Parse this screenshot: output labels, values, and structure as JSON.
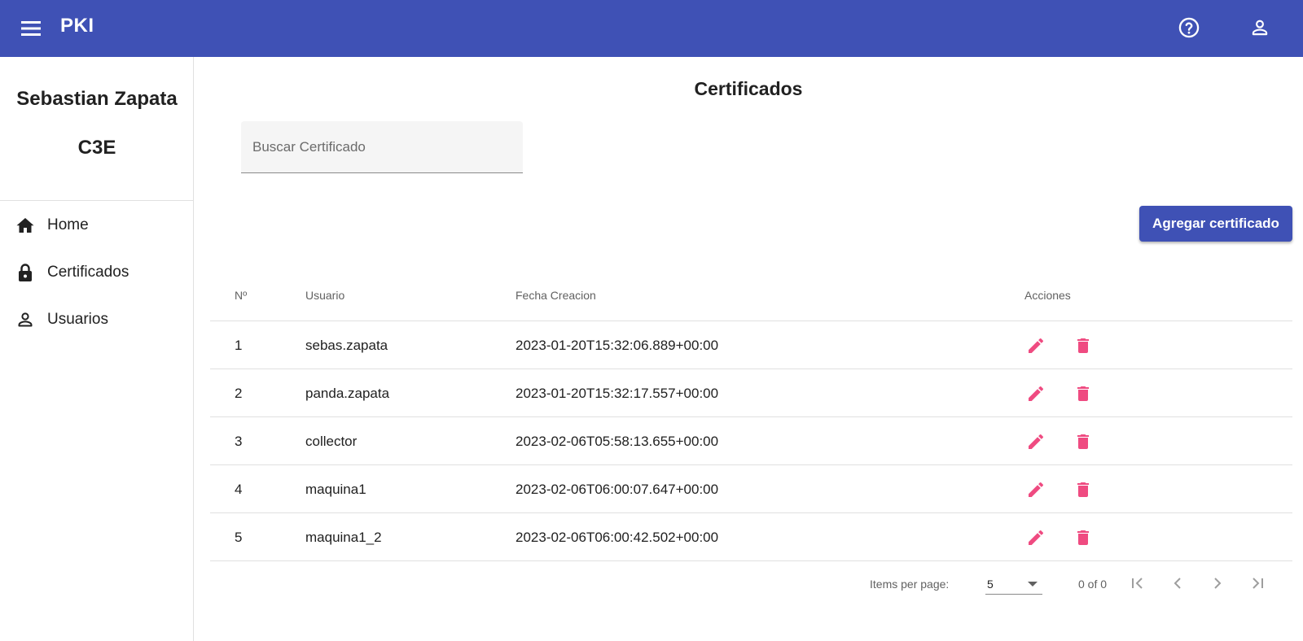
{
  "app": {
    "title": "PKI"
  },
  "colors": {
    "primary": "#3f51b5",
    "accent": "#ef4b81"
  },
  "icons": {
    "menu": "menu-icon",
    "help": "help-circle-icon",
    "account": "account-icon",
    "home": "home-icon",
    "lock": "lock-icon",
    "users": "person-icon",
    "edit": "pencil-icon",
    "delete": "trash-icon"
  },
  "sidebar": {
    "user_name": "Sebastian Zapata",
    "user_org": "C3E",
    "items": [
      {
        "label": "Home",
        "icon": "home-icon"
      },
      {
        "label": "Certificados",
        "icon": "lock-icon"
      },
      {
        "label": "Usuarios",
        "icon": "person-icon"
      }
    ]
  },
  "main": {
    "title": "Certificados",
    "search_placeholder": "Buscar Certificado",
    "search_value": "",
    "add_button": "Agregar certificado"
  },
  "table": {
    "headers": {
      "num": "Nº",
      "user": "Usuario",
      "date": "Fecha Creacion",
      "actions": "Acciones"
    },
    "rows": [
      {
        "num": "1",
        "user": "sebas.zapata",
        "date": "2023-01-20T15:32:06.889+00:00"
      },
      {
        "num": "2",
        "user": "panda.zapata",
        "date": "2023-01-20T15:32:17.557+00:00"
      },
      {
        "num": "3",
        "user": "collector",
        "date": "2023-02-06T05:58:13.655+00:00"
      },
      {
        "num": "4",
        "user": "maquina1",
        "date": "2023-02-06T06:00:07.647+00:00"
      },
      {
        "num": "5",
        "user": "maquina1_2",
        "date": "2023-02-06T06:00:42.502+00:00"
      }
    ]
  },
  "paginator": {
    "items_per_page_label": "Items per page:",
    "items_per_page": "5",
    "range": "0 of 0"
  }
}
